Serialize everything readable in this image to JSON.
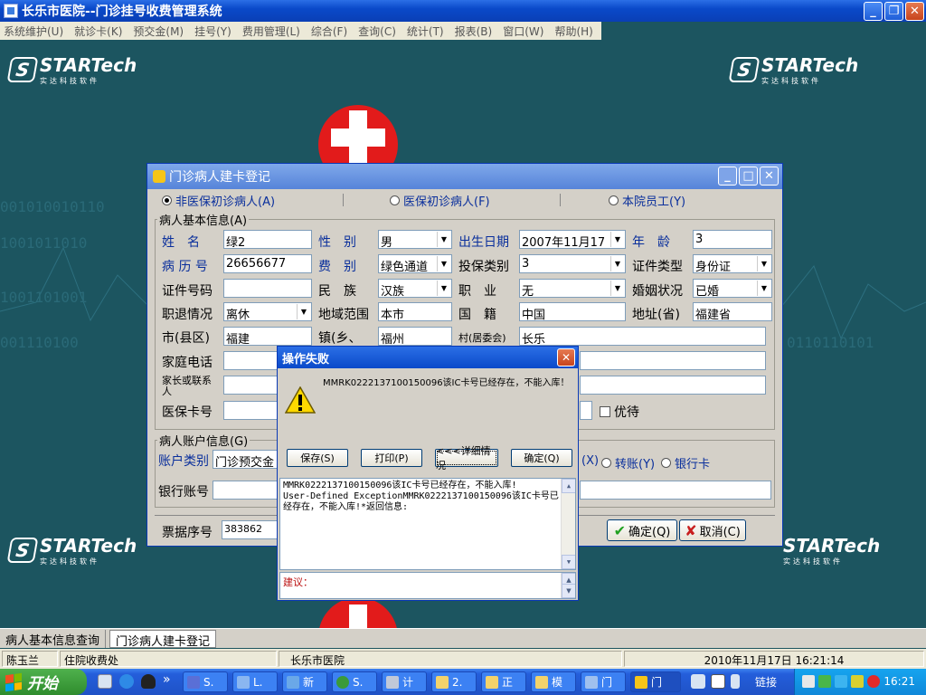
{
  "app": {
    "title": "长乐市医院--门诊挂号收费管理系统",
    "menu": [
      "系统维护(U)",
      "就诊卡(K)",
      "预交金(M)",
      "挂号(Y)",
      "费用管理(L)",
      "综合(F)",
      "查询(C)",
      "统计(T)",
      "报表(B)",
      "窗口(W)",
      "帮助(H)"
    ],
    "window_controls": {
      "minimize": "_",
      "restore": "❐",
      "close": "✕"
    }
  },
  "branding": {
    "logo_text": "STARTech",
    "logo_sub": "实达科技软件",
    "colors": {
      "background": "#1c5560",
      "cross_red": "#e21b1b"
    }
  },
  "reg_dialog": {
    "title": "门诊病人建卡登记",
    "patient_types": [
      {
        "label": "非医保初诊病人(A)",
        "selected": true
      },
      {
        "label": "医保初诊病人(F)",
        "selected": false
      },
      {
        "label": "本院员工(Y)",
        "selected": false
      }
    ],
    "basic_group": {
      "legend": "病人基本信息(A)",
      "name_label": "姓　名",
      "name_value": "绿2",
      "sex_label": "性　别",
      "sex_value": "男",
      "birth_label": "出生日期",
      "birth_value": "2007年11月17",
      "age_label": "年　龄",
      "age_value": "3",
      "record_label": "病 历 号",
      "record_value": "26656677",
      "fee_label": "费　别",
      "fee_value": "绿色通道",
      "ins_type_label": "投保类别",
      "ins_type_value": "3",
      "id_type_label": "证件类型",
      "id_type_value": "身份证",
      "id_no_label": "证件号码",
      "id_no_value": "",
      "nation_label": "民　族",
      "nation_value": "汉族",
      "job_label": "职　业",
      "job_value": "无",
      "marital_label": "婚姻状况",
      "marital_value": "已婚",
      "retire_label": "职退情况",
      "retire_value": "离休",
      "area_label": "地域范围",
      "area_value": "本市",
      "nationality_label": "国　籍",
      "nationality_value": "中国",
      "province_label": "地址(省)",
      "province_value": "福建省",
      "city_label": "市(县区)",
      "city_value": "福建",
      "town_label": "镇(乡、",
      "town_value": "福州",
      "village_label": "村(居委会)",
      "village_value": "长乐",
      "home_phone_label": "家庭电话",
      "guardian_label": "家长或联系人",
      "ins_card_label": "医保卡号",
      "priority_label": "优待"
    },
    "account_group": {
      "legend": "病人账户信息(G)",
      "account_type_label": "账户类别",
      "account_type_value": "门诊预交金",
      "opt_x": "(X)",
      "opt_transfer": "转账(Y)",
      "opt_bank": "银行卡",
      "bank_label": "银行账号"
    },
    "receipt_label": "票据序号",
    "receipt_value": "383862",
    "ok_label": "确定(Q)",
    "cancel_label": "取消(C)"
  },
  "error_dialog": {
    "title": "操作失败",
    "message": "MMRK0222137100150096该IC卡号已经存在，不能入库！",
    "buttons": {
      "save": "保存(S)",
      "print": "打印(P)",
      "details": "<<<详细情况",
      "ok": "确定(Q)"
    },
    "detail": "MMRK0222137100150096该IC卡号已经存在，不能入库!\nUser-Defined ExceptionMMRK0222137100150096该IC卡号已经存在，不能入库!*返回信息:",
    "suggest_label": "建议："
  },
  "tabs": [
    "病人基本信息查询",
    "门诊病人建卡登记"
  ],
  "status": {
    "user": "陈玉兰",
    "dept": "住院收费处",
    "hospital": "长乐市医院",
    "datetime": "2010年11月17日 16:21:14"
  },
  "taskbar": {
    "start": "开始",
    "more": "»",
    "buttons": [
      "S.",
      "L.",
      "新",
      "S.",
      "计",
      "2.",
      "正",
      "模",
      "门",
      "门"
    ],
    "links": "链接",
    "clock": "16:21"
  }
}
